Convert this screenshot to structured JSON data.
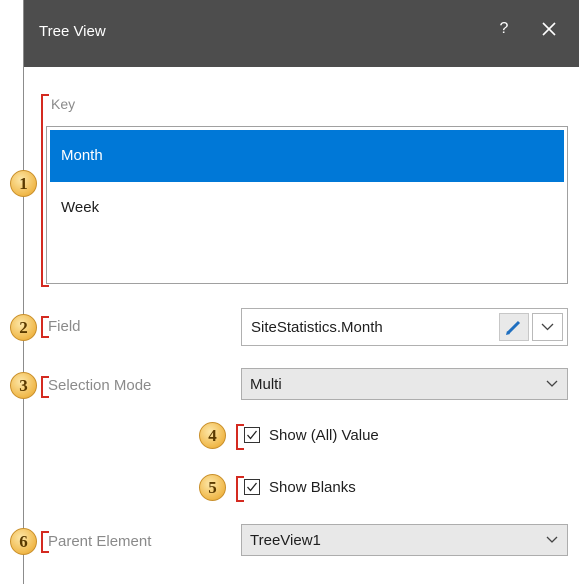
{
  "window": {
    "title": "Tree View",
    "help_label": "?"
  },
  "key": {
    "label": "Key",
    "items": [
      {
        "label": "Month",
        "selected": true
      },
      {
        "label": "Week",
        "selected": false
      }
    ]
  },
  "field": {
    "label": "Field",
    "value": "SiteStatistics.Month"
  },
  "selection_mode": {
    "label": "Selection Mode",
    "value": "Multi"
  },
  "show_all_value": {
    "label": "Show (All) Value",
    "checked": true
  },
  "show_blanks": {
    "label": "Show Blanks",
    "checked": true
  },
  "parent_element": {
    "label": "Parent Element",
    "value": "TreeView1"
  },
  "callouts": [
    "1",
    "2",
    "3",
    "4",
    "5",
    "6"
  ],
  "colors": {
    "titlebar": "#4d4d4d",
    "selection": "#0078d7",
    "callout_bracket": "#d42a20",
    "callout_badge": "#f0b84a"
  }
}
